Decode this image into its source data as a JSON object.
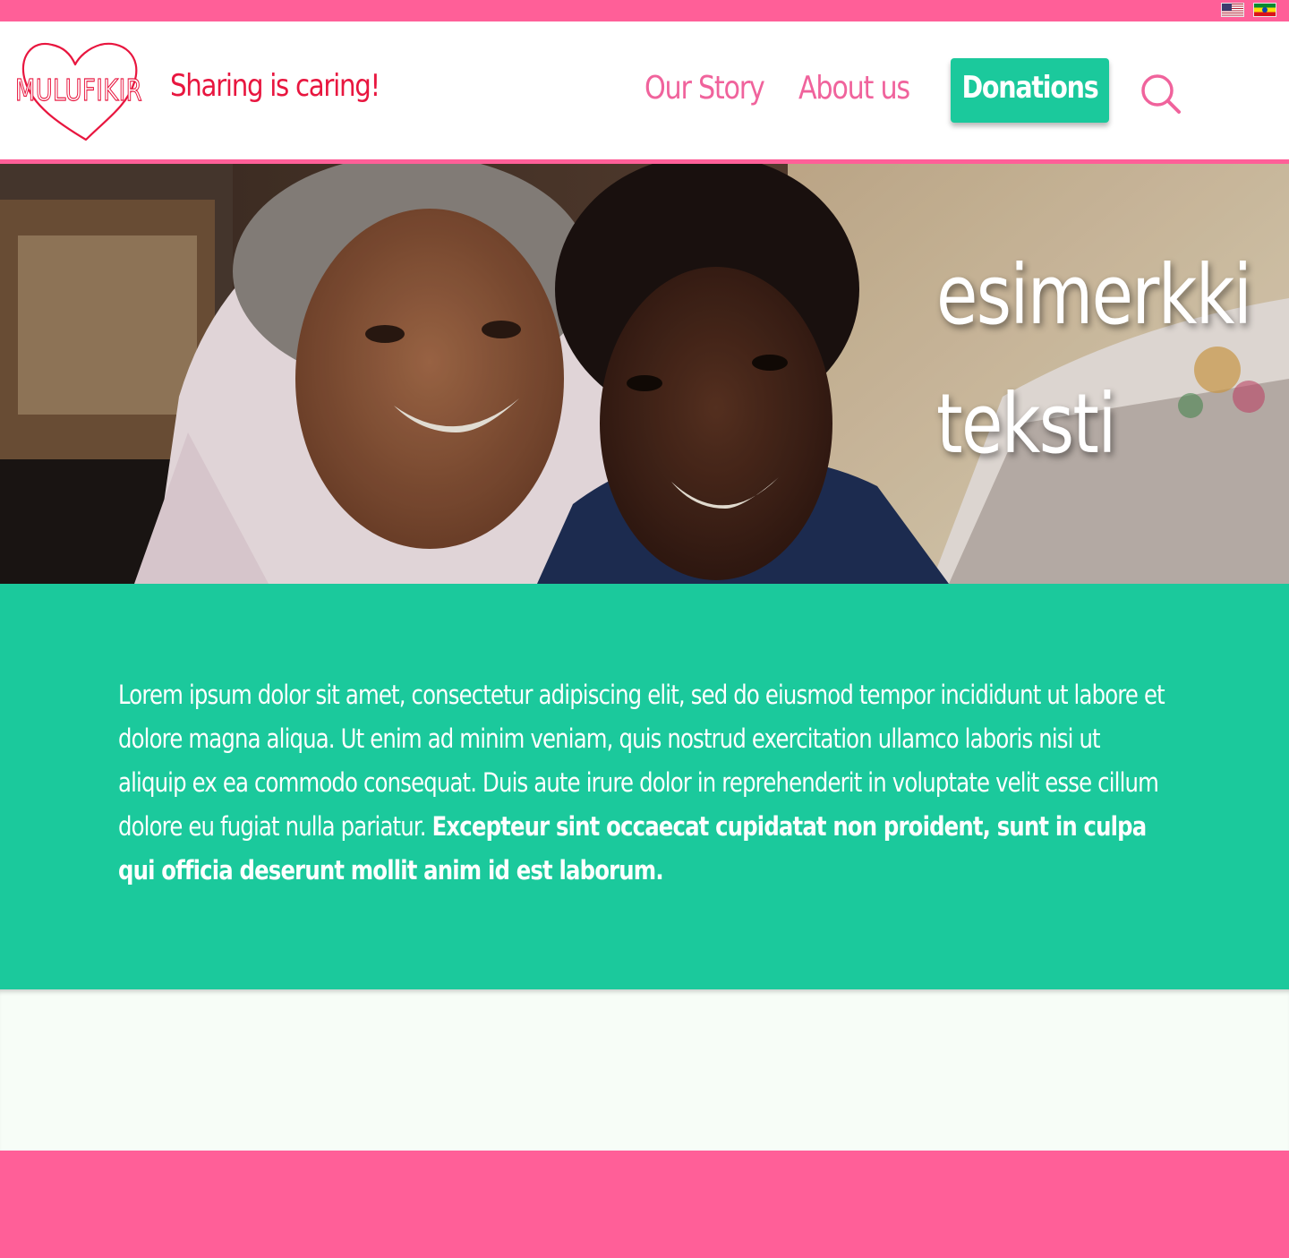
{
  "topbar": {
    "languages": [
      {
        "flag": "us-flag-icon",
        "lang": "en"
      },
      {
        "flag": "ethiopia-flag-icon",
        "lang": "am"
      }
    ]
  },
  "header": {
    "logo_text": "MULUFIKIR",
    "tagline": "Sharing is caring!",
    "nav": {
      "our_story": "Our Story",
      "about_us": "About us",
      "donations": "Donations"
    },
    "search_icon": "search-icon"
  },
  "hero": {
    "line1": "esimerkki",
    "line2": "teksti"
  },
  "content": {
    "paragraph_regular": "Lorem ipsum dolor sit amet, consectetur adipiscing elit, sed do eiusmod tempor incididunt ut labore et dolore magna aliqua. Ut enim ad minim veniam, quis nostrud exercitation ullamco laboris nisi ut aliquip ex ea commodo consequat. Duis aute irure dolor in reprehenderit in voluptate velit esse cillum dolore eu fugiat nulla pariatur. ",
    "paragraph_bold": "Excepteur sint occaecat cupidatat non proident, sunt in culpa qui officia deserunt mollit anim id est laborum."
  },
  "colors": {
    "pink": "#ff5f98",
    "red_text": "#e8163f",
    "nav_pink": "#f0639c",
    "teal": "#1bc99c",
    "light_bg": "#f7fdf7"
  }
}
